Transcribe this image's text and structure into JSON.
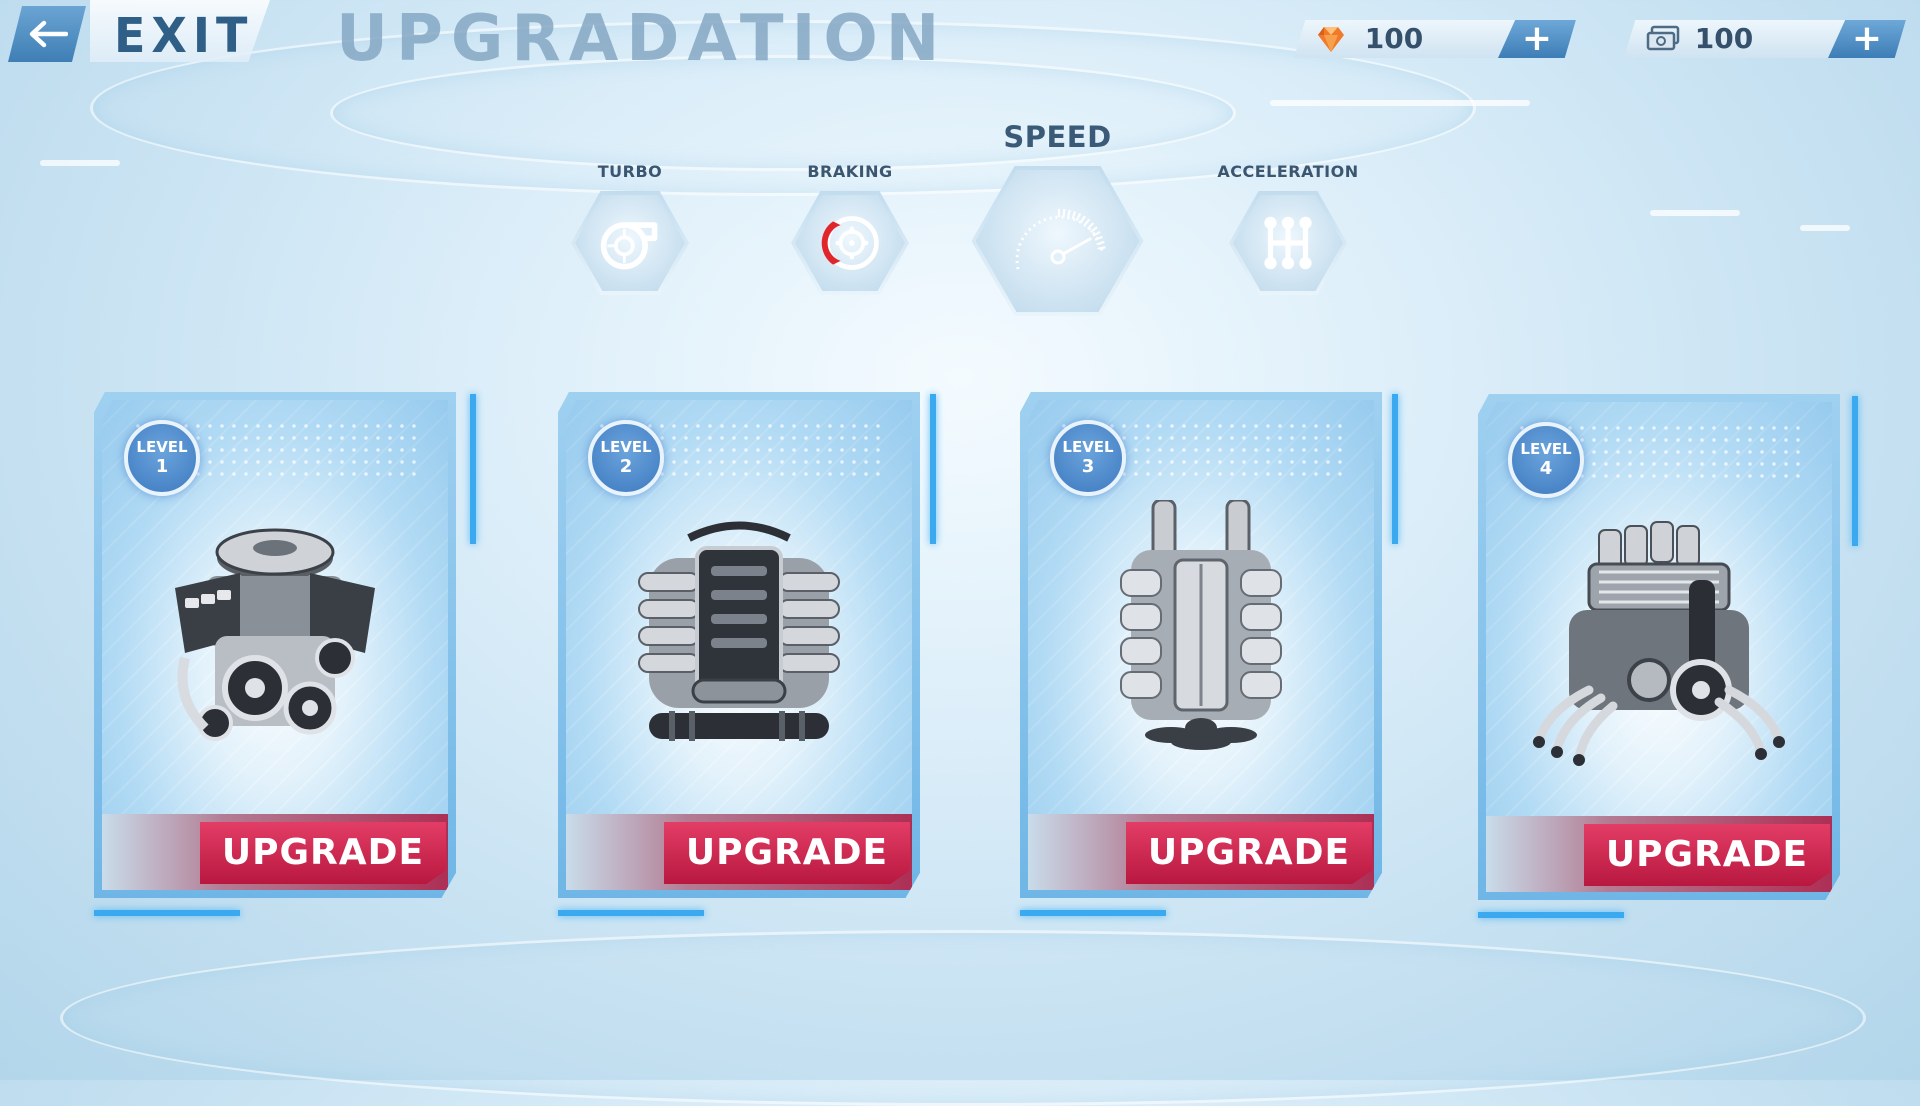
{
  "header": {
    "exit_label": "EXIT",
    "title": "UPGRADATION"
  },
  "currency": {
    "gems": {
      "amount": "100",
      "icon": "gem-icon",
      "add_label": "+"
    },
    "cash": {
      "amount": "100",
      "icon": "cash-icon",
      "add_label": "+"
    }
  },
  "categories": [
    {
      "label": "TURBO",
      "icon": "turbo-icon",
      "active": false
    },
    {
      "label": "BRAKING",
      "icon": "brake-disc-icon",
      "active": false
    },
    {
      "label": "SPEED",
      "icon": "speedometer-icon",
      "active": true
    },
    {
      "label": "ACCELERATION",
      "icon": "gear-shift-icon",
      "active": false
    }
  ],
  "cards": [
    {
      "level_label": "LEVEL",
      "level": "1",
      "button": "UPGRADE",
      "icon": "v8-engine-icon"
    },
    {
      "level_label": "LEVEL",
      "level": "2",
      "button": "UPGRADE",
      "icon": "inline-engine-icon"
    },
    {
      "level_label": "LEVEL",
      "level": "3",
      "button": "UPGRADE",
      "icon": "twin-exhaust-engine-icon"
    },
    {
      "level_label": "LEVEL",
      "level": "4",
      "button": "UPGRADE",
      "icon": "supercharged-engine-icon"
    }
  ],
  "colors": {
    "accent_blue": "#3aa9f0",
    "upgrade_red": "#d42a55",
    "brake_red": "#e0262c"
  }
}
